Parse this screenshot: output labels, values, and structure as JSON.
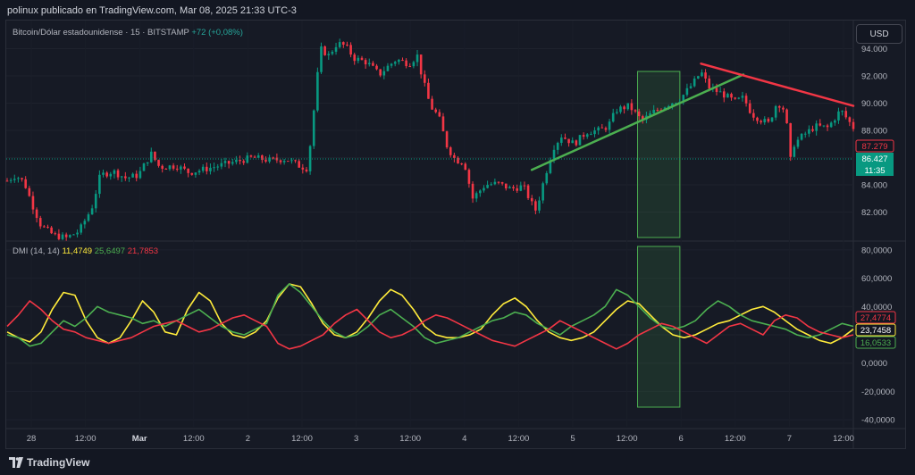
{
  "header": {
    "text": "polinux publicado en TradingView.com, Mar 08, 2025 21:33 UTC-3"
  },
  "symbol_legend": {
    "title": "Bitcoin/Dólar estadounidense · 15 · BITSTAMP",
    "change": "+72 (+0,08%)",
    "change_color": "#26a69a"
  },
  "currency_button": "USD",
  "dmi_legend": {
    "title": "DMI (14, 14)",
    "adx": "11,4749",
    "plus_di": "25,6497",
    "minus_di": "21,7853",
    "adx_color": "#ffeb3b",
    "plus_color": "#4caf50",
    "minus_color": "#f23645"
  },
  "footer": {
    "brand": "TradingView",
    "logo_icon": "tradingview-logo-icon"
  },
  "chart_data": [
    {
      "type": "candlestick",
      "title": "Bitcoin/Dólar estadounidense · 15 · BITSTAMP",
      "ylim": [
        80000,
        96000
      ],
      "price_axis_ticks": [
        "82.000",
        "84.000",
        "86.000",
        "88.000",
        "90.000",
        "92.000",
        "94.000"
      ],
      "time_axis_labels": [
        "28",
        "12:00",
        "Mar",
        "12:00",
        "2",
        "12:00",
        "3",
        "12:00",
        "4",
        "12:00",
        "5",
        "12:00",
        "6",
        "12:00",
        "7",
        "12:00"
      ],
      "close_path": [
        [
          0,
          84300
        ],
        [
          0.01,
          84700
        ],
        [
          0.02,
          84200
        ],
        [
          0.03,
          82500
        ],
        [
          0.04,
          81000
        ],
        [
          0.055,
          80300
        ],
        [
          0.07,
          80100
        ],
        [
          0.085,
          80600
        ],
        [
          0.1,
          82300
        ],
        [
          0.11,
          84700
        ],
        [
          0.125,
          85000
        ],
        [
          0.14,
          84500
        ],
        [
          0.155,
          84700
        ],
        [
          0.17,
          86300
        ],
        [
          0.18,
          85300
        ],
        [
          0.2,
          85400
        ],
        [
          0.215,
          84900
        ],
        [
          0.23,
          85100
        ],
        [
          0.25,
          85400
        ],
        [
          0.27,
          85700
        ],
        [
          0.29,
          86000
        ],
        [
          0.31,
          85800
        ],
        [
          0.33,
          85900
        ],
        [
          0.345,
          85400
        ],
        [
          0.355,
          85200
        ],
        [
          0.36,
          88000
        ],
        [
          0.37,
          94000
        ],
        [
          0.38,
          93500
        ],
        [
          0.39,
          94400
        ],
        [
          0.4,
          94200
        ],
        [
          0.41,
          93300
        ],
        [
          0.425,
          93000
        ],
        [
          0.44,
          92100
        ],
        [
          0.45,
          92700
        ],
        [
          0.46,
          93200
        ],
        [
          0.475,
          92900
        ],
        [
          0.485,
          93500
        ],
        [
          0.49,
          92000
        ],
        [
          0.5,
          89800
        ],
        [
          0.51,
          89000
        ],
        [
          0.52,
          86800
        ],
        [
          0.53,
          85800
        ],
        [
          0.54,
          85700
        ],
        [
          0.55,
          83000
        ],
        [
          0.565,
          84000
        ],
        [
          0.58,
          84100
        ],
        [
          0.595,
          83700
        ],
        [
          0.61,
          83900
        ],
        [
          0.62,
          82600
        ],
        [
          0.625,
          82100
        ],
        [
          0.635,
          84500
        ],
        [
          0.645,
          86700
        ],
        [
          0.655,
          87600
        ],
        [
          0.67,
          87000
        ],
        [
          0.685,
          87900
        ],
        [
          0.7,
          88000
        ],
        [
          0.71,
          88300
        ],
        [
          0.72,
          89500
        ],
        [
          0.735,
          89800
        ],
        [
          0.75,
          88700
        ],
        [
          0.765,
          89400
        ],
        [
          0.78,
          89900
        ],
        [
          0.795,
          90300
        ],
        [
          0.81,
          91400
        ],
        [
          0.82,
          92300
        ],
        [
          0.83,
          91100
        ],
        [
          0.845,
          90700
        ],
        [
          0.86,
          90100
        ],
        [
          0.87,
          90400
        ],
        [
          0.88,
          89200
        ],
        [
          0.89,
          88800
        ],
        [
          0.9,
          88500
        ],
        [
          0.91,
          90100
        ],
        [
          0.92,
          89400
        ],
        [
          0.925,
          85600
        ],
        [
          0.93,
          87000
        ],
        [
          0.94,
          87600
        ],
        [
          0.955,
          88300
        ],
        [
          0.97,
          88200
        ],
        [
          0.985,
          89500
        ],
        [
          1.0,
          88200
        ]
      ],
      "last_price_labels": [
        {
          "value": "87.279",
          "color": "#f23645"
        },
        {
          "value": "86.427",
          "color": "#089981"
        },
        {
          "value": "11:35",
          "color": "#089981"
        }
      ],
      "trend_lines": [
        {
          "name": "green-trendline",
          "color": "#4caf50",
          "from": [
            0.62,
            85100
          ],
          "to": [
            0.87,
            92100
          ]
        },
        {
          "name": "red-trendline",
          "color": "#f23645",
          "from": [
            0.82,
            92900
          ],
          "to": [
            1.0,
            89800
          ]
        }
      ],
      "highlight_zone": {
        "color": "#4caf50",
        "x": [
          0.745,
          0.795
        ]
      }
    },
    {
      "type": "line",
      "title": "DMI (14, 14)",
      "ylim": [
        -45,
        85
      ],
      "value_axis_ticks": [
        "80,0000",
        "60,0000",
        "40,0000",
        "20,0000",
        "0,0000",
        "-20,0000",
        "-40,0000"
      ],
      "series": [
        {
          "name": "ADX",
          "color": "#ffeb3b",
          "values": [
            22,
            18,
            15,
            22,
            38,
            50,
            48,
            30,
            18,
            14,
            18,
            30,
            44,
            36,
            22,
            20,
            38,
            50,
            44,
            28,
            20,
            18,
            22,
            30,
            46,
            56,
            54,
            42,
            28,
            20,
            18,
            22,
            32,
            44,
            52,
            48,
            38,
            26,
            20,
            18,
            18,
            20,
            24,
            34,
            42,
            46,
            40,
            30,
            22,
            18,
            16,
            18,
            22,
            30,
            38,
            44,
            42,
            34,
            26,
            20,
            18,
            20,
            24,
            28,
            30,
            34,
            38,
            40,
            36,
            30,
            24,
            20,
            16,
            14,
            18,
            24
          ]
        },
        {
          "name": "+DI",
          "color": "#4caf50",
          "values": [
            20,
            18,
            12,
            14,
            22,
            30,
            26,
            32,
            40,
            36,
            34,
            32,
            28,
            30,
            26,
            30,
            34,
            38,
            32,
            26,
            22,
            20,
            24,
            28,
            48,
            56,
            50,
            40,
            30,
            22,
            18,
            20,
            26,
            34,
            38,
            32,
            26,
            18,
            14,
            16,
            18,
            22,
            26,
            30,
            32,
            36,
            34,
            28,
            24,
            20,
            26,
            30,
            34,
            40,
            52,
            48,
            40,
            32,
            26,
            24,
            26,
            30,
            38,
            44,
            40,
            34,
            30,
            28,
            26,
            24,
            20,
            18,
            20,
            24,
            28,
            26
          ]
        },
        {
          "name": "-DI",
          "color": "#f23645",
          "values": [
            26,
            34,
            44,
            38,
            30,
            24,
            22,
            18,
            16,
            14,
            16,
            18,
            22,
            26,
            28,
            30,
            26,
            22,
            24,
            28,
            32,
            34,
            30,
            26,
            14,
            10,
            12,
            16,
            20,
            28,
            34,
            38,
            30,
            22,
            18,
            20,
            24,
            30,
            34,
            32,
            28,
            24,
            20,
            16,
            14,
            12,
            16,
            20,
            24,
            30,
            26,
            22,
            18,
            14,
            10,
            14,
            20,
            24,
            28,
            26,
            22,
            18,
            14,
            20,
            26,
            28,
            24,
            20,
            30,
            34,
            32,
            26,
            22,
            20,
            18,
            20
          ]
        }
      ],
      "last_value_labels": [
        {
          "value": "27,4774",
          "color": "#f23645"
        },
        {
          "value": "23,7458",
          "color": "#ffeb3b"
        },
        {
          "value": "16,0533",
          "color": "#4caf50"
        }
      ],
      "highlight_zone": {
        "color": "#4caf50",
        "x": [
          0.745,
          0.795
        ]
      }
    }
  ]
}
